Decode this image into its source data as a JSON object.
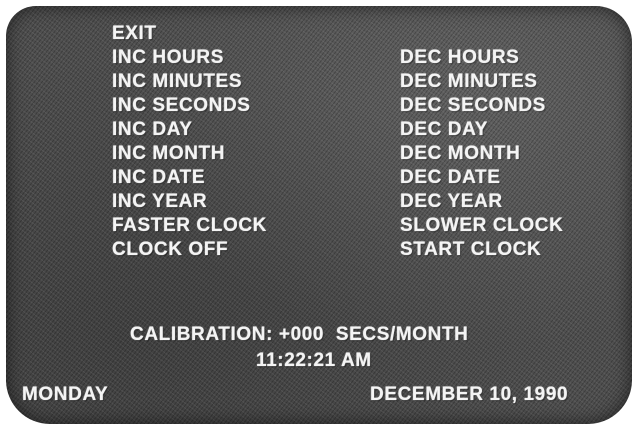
{
  "menu": {
    "left": [
      {
        "id": "exit",
        "label": "EXIT"
      },
      {
        "id": "inc-hours",
        "label": "INC HOURS"
      },
      {
        "id": "inc-minutes",
        "label": "INC MINUTES"
      },
      {
        "id": "inc-seconds",
        "label": "INC SECONDS"
      },
      {
        "id": "inc-day",
        "label": "INC DAY"
      },
      {
        "id": "inc-month",
        "label": "INC MONTH"
      },
      {
        "id": "inc-date",
        "label": "INC DATE"
      },
      {
        "id": "inc-year",
        "label": "INC YEAR"
      },
      {
        "id": "faster-clock",
        "label": "FASTER CLOCK"
      },
      {
        "id": "clock-off",
        "label": "CLOCK OFF"
      }
    ],
    "right": [
      {
        "id": "dec-hours",
        "label": "DEC HOURS"
      },
      {
        "id": "dec-minutes",
        "label": "DEC MINUTES"
      },
      {
        "id": "dec-seconds",
        "label": "DEC SECONDS"
      },
      {
        "id": "dec-day",
        "label": "DEC DAY"
      },
      {
        "id": "dec-month",
        "label": "DEC MONTH"
      },
      {
        "id": "dec-date",
        "label": "DEC DATE"
      },
      {
        "id": "dec-year",
        "label": "DEC YEAR"
      },
      {
        "id": "slower-clock",
        "label": "SLOWER CLOCK"
      },
      {
        "id": "start-clock",
        "label": "START CLOCK"
      }
    ]
  },
  "status": {
    "calibration": "CALIBRATION: +000  SECS/MONTH",
    "time": "11:22:21 AM",
    "day": "MONDAY",
    "date": "DECEMBER 10, 1990"
  },
  "colors": {
    "screen_background": "#4f4f4f",
    "text": "#f4f4f4"
  }
}
